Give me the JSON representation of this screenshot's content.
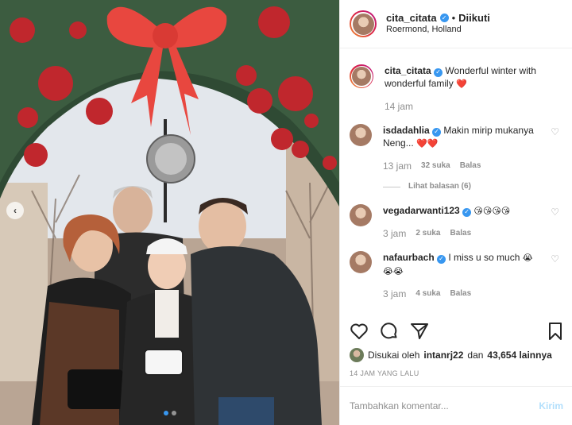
{
  "colors": {
    "accent": "#3897f0",
    "muted": "#8e8e8e",
    "text": "#262626",
    "heart": "#ed4956"
  },
  "post": {
    "username": "cita_citata",
    "follow_separator": "•",
    "follow_state": "Diikuti",
    "location": "Roermond, Holland",
    "carousel": {
      "dots": 2,
      "active_index": 0
    }
  },
  "caption": {
    "username": "cita_citata",
    "text": "Wonderful winter with wonderful family",
    "emoji": "❤️",
    "time": "14 jam"
  },
  "comments": [
    {
      "username": "isdadahlia",
      "verified": true,
      "text": "Makin mirip mukanya Neng...",
      "emoji": "❤️❤️",
      "time": "13 jam",
      "likes": "32 suka",
      "reply_label": "Balas",
      "view_replies": "Lihat balasan (6)"
    },
    {
      "username": "vegadarwanti123",
      "verified": true,
      "text": "",
      "emoji": "😘😘😘😘",
      "time": "3 jam",
      "likes": "2 suka",
      "reply_label": "Balas"
    },
    {
      "username": "nafaurbach",
      "verified": true,
      "text": "I miss u so much",
      "emoji": "😭😭😭",
      "time": "3 jam",
      "likes": "4 suka",
      "reply_label": "Balas"
    }
  ],
  "likes": {
    "prefix": "Disukai oleh",
    "user": "intanrj22",
    "connector": "dan",
    "count": "43,654 lainnya"
  },
  "timestamp": "14 JAM YANG LALU",
  "comment_input": {
    "placeholder": "Tambahkan komentar...",
    "post_label": "Kirim"
  },
  "icons": [
    "verified-badge-icon",
    "heart-icon",
    "comment-icon",
    "share-icon",
    "bookmark-icon",
    "chevron-left-icon"
  ]
}
